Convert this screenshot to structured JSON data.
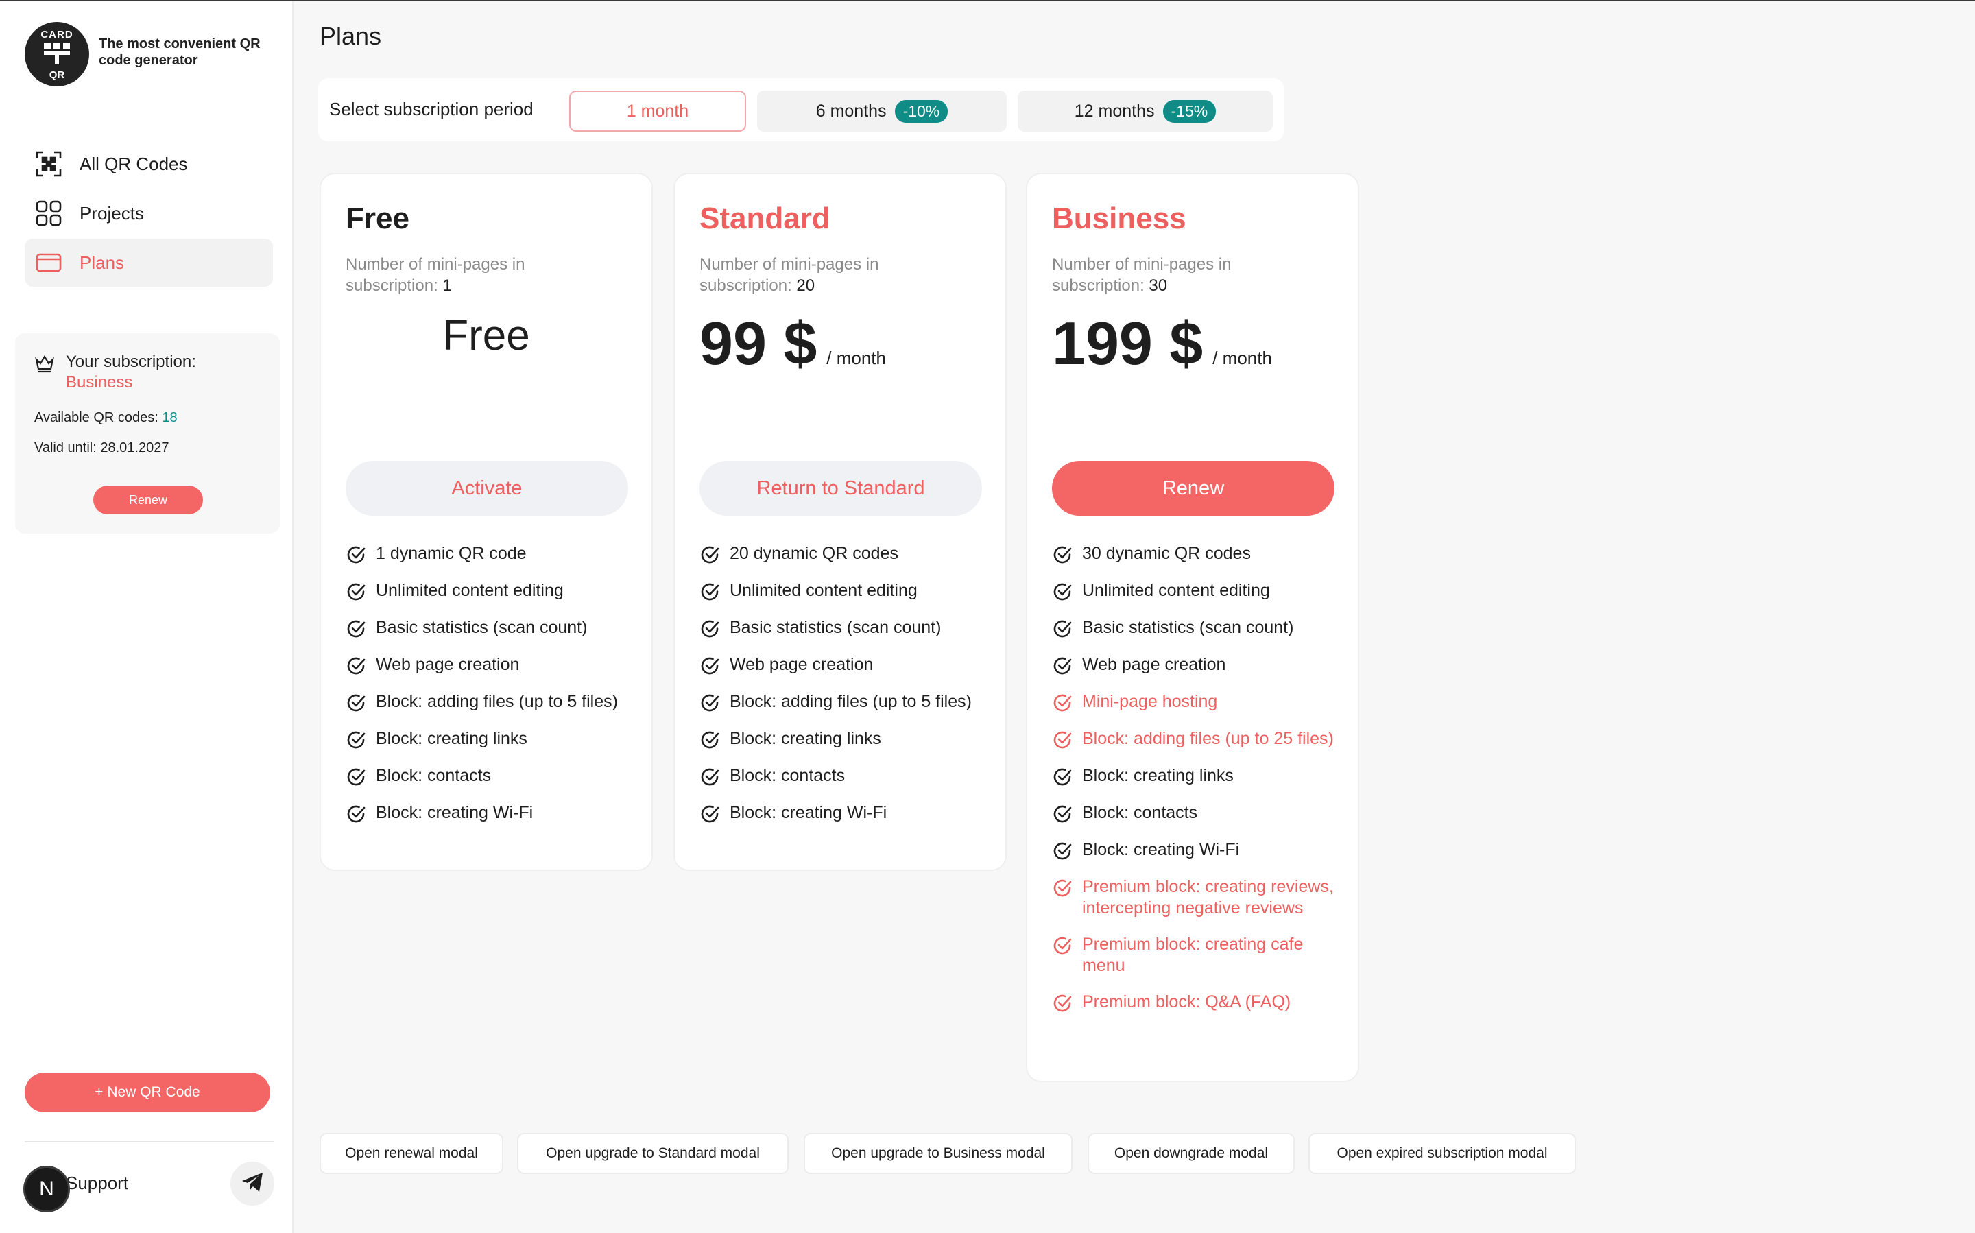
{
  "app": {
    "logo_top": "CARD",
    "logo_bottom": "QR",
    "tagline": "The most convenient QR code generator"
  },
  "sidebar": {
    "items": [
      {
        "label": "All QR Codes",
        "icon": "qr-scan-icon"
      },
      {
        "label": "Projects",
        "icon": "grid-icon"
      },
      {
        "label": "Plans",
        "icon": "card-icon",
        "active": true
      }
    ],
    "subscription": {
      "title": "Your subscription:",
      "plan": "Business",
      "available_label": "Available QR codes:",
      "available_value": "18",
      "valid_label": "Valid until:",
      "valid_value": "28.01.2027",
      "renew_label": "Renew"
    },
    "new_qr_label": "+ New QR Code",
    "support_label": "Support",
    "avatar_letter": "N"
  },
  "main": {
    "title": "Plans",
    "period": {
      "label": "Select subscription period",
      "options": [
        {
          "label": "1 month",
          "discount": "",
          "active": true
        },
        {
          "label": "6 months",
          "discount": "-10%"
        },
        {
          "label": "12 months",
          "discount": "-15%"
        }
      ]
    },
    "plans": [
      {
        "name": "Free",
        "mini_label": "Number of mini-pages in subscription:",
        "mini_value": "1",
        "price": "Free",
        "button": "Activate",
        "features": [
          {
            "text": "1 dynamic QR code"
          },
          {
            "text": "Unlimited content editing"
          },
          {
            "text": "Basic statistics (scan count)"
          },
          {
            "text": "Web page creation"
          },
          {
            "text": "Block: adding files (up to 5 files)"
          },
          {
            "text": "Block: creating links"
          },
          {
            "text": "Block: contacts"
          },
          {
            "text": "Block: creating Wi-Fi"
          }
        ]
      },
      {
        "name": "Standard",
        "mini_label": "Number of mini-pages in subscription:",
        "mini_value": "20",
        "price": "99 $",
        "per": "/ month",
        "button": "Return to Standard",
        "features": [
          {
            "text": "20 dynamic QR codes"
          },
          {
            "text": "Unlimited content editing"
          },
          {
            "text": "Basic statistics (scan count)"
          },
          {
            "text": "Web page creation"
          },
          {
            "text": "Block: adding files (up to 5 files)"
          },
          {
            "text": "Block: creating links"
          },
          {
            "text": "Block: contacts"
          },
          {
            "text": "Block: creating Wi-Fi"
          }
        ]
      },
      {
        "name": "Business",
        "mini_label": "Number of mini-pages in subscription:",
        "mini_value": "30",
        "price": "199 $",
        "per": "/ month",
        "button": "Renew",
        "features": [
          {
            "text": "30 dynamic QR codes"
          },
          {
            "text": "Unlimited content editing"
          },
          {
            "text": "Basic statistics (scan count)"
          },
          {
            "text": "Web page creation"
          },
          {
            "text": "Mini-page hosting",
            "highlight": true
          },
          {
            "text": "Block: adding files (up to 25 files)",
            "highlight": true
          },
          {
            "text": "Block: creating links"
          },
          {
            "text": "Block: contacts"
          },
          {
            "text": "Block: creating Wi-Fi"
          },
          {
            "text": "Premium block: creating reviews, intercepting negative reviews",
            "highlight": true
          },
          {
            "text": "Premium block: creating cafe menu",
            "highlight": true
          },
          {
            "text": "Premium block: Q&A (FAQ)",
            "highlight": true
          }
        ]
      }
    ],
    "modal_buttons": [
      "Open renewal modal",
      "Open upgrade to Standard modal",
      "Open upgrade to Business modal",
      "Open downgrade modal",
      "Open expired subscription modal"
    ]
  },
  "colors": {
    "accent": "#f46565",
    "accent_text": "#ee5f5f",
    "teal": "#108c86"
  }
}
